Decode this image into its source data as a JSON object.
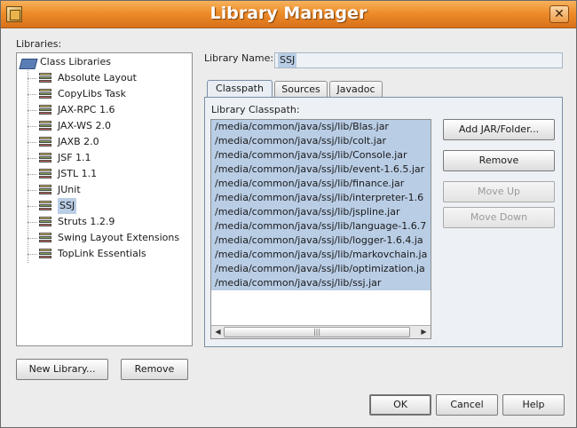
{
  "window": {
    "title": "Library Manager",
    "close_glyph": "✕"
  },
  "libraries": {
    "label": "Libraries:",
    "root": "Class Libraries",
    "items": [
      "Absolute Layout",
      "CopyLibs Task",
      "JAX-RPC 1.6",
      "JAX-WS 2.0",
      "JAXB 2.0",
      "JSF 1.1",
      "JSTL 1.1",
      "JUnit",
      "SSJ",
      "Struts 1.2.9",
      "Swing Layout Extensions",
      "TopLink Essentials"
    ],
    "selected": "SSJ",
    "new_library_button": "New Library...",
    "remove_button": "Remove"
  },
  "library_name": {
    "label": "Library Name:",
    "value": "SSJ"
  },
  "tabs": [
    {
      "label": "Classpath",
      "active": true
    },
    {
      "label": "Sources",
      "active": false
    },
    {
      "label": "Javadoc",
      "active": false
    }
  ],
  "classpath": {
    "label": "Library Classpath:",
    "entries": [
      "/media/common/java/ssj/lib/Blas.jar",
      "/media/common/java/ssj/lib/colt.jar",
      "/media/common/java/ssj/lib/Console.jar",
      "/media/common/java/ssj/lib/event-1.6.5.jar",
      "/media/common/java/ssj/lib/finance.jar",
      "/media/common/java/ssj/lib/interpreter-1.6",
      "/media/common/java/ssj/lib/jspline.jar",
      "/media/common/java/ssj/lib/language-1.6.7",
      "/media/common/java/ssj/lib/logger-1.6.4.ja",
      "/media/common/java/ssj/lib/markovchain.ja",
      "/media/common/java/ssj/lib/optimization.ja",
      "/media/common/java/ssj/lib/ssj.jar"
    ],
    "scroll_left": "◀",
    "scroll_right": "▶",
    "scroll_grip": "|||",
    "buttons": {
      "add": "Add JAR/Folder...",
      "remove": "Remove",
      "move_up": "Move Up",
      "move_down": "Move Down"
    }
  },
  "footer": {
    "ok": "OK",
    "cancel": "Cancel",
    "help": "Help"
  },
  "colors": {
    "titlebar": "#ee8d2a",
    "selection": "#b9cde5"
  }
}
